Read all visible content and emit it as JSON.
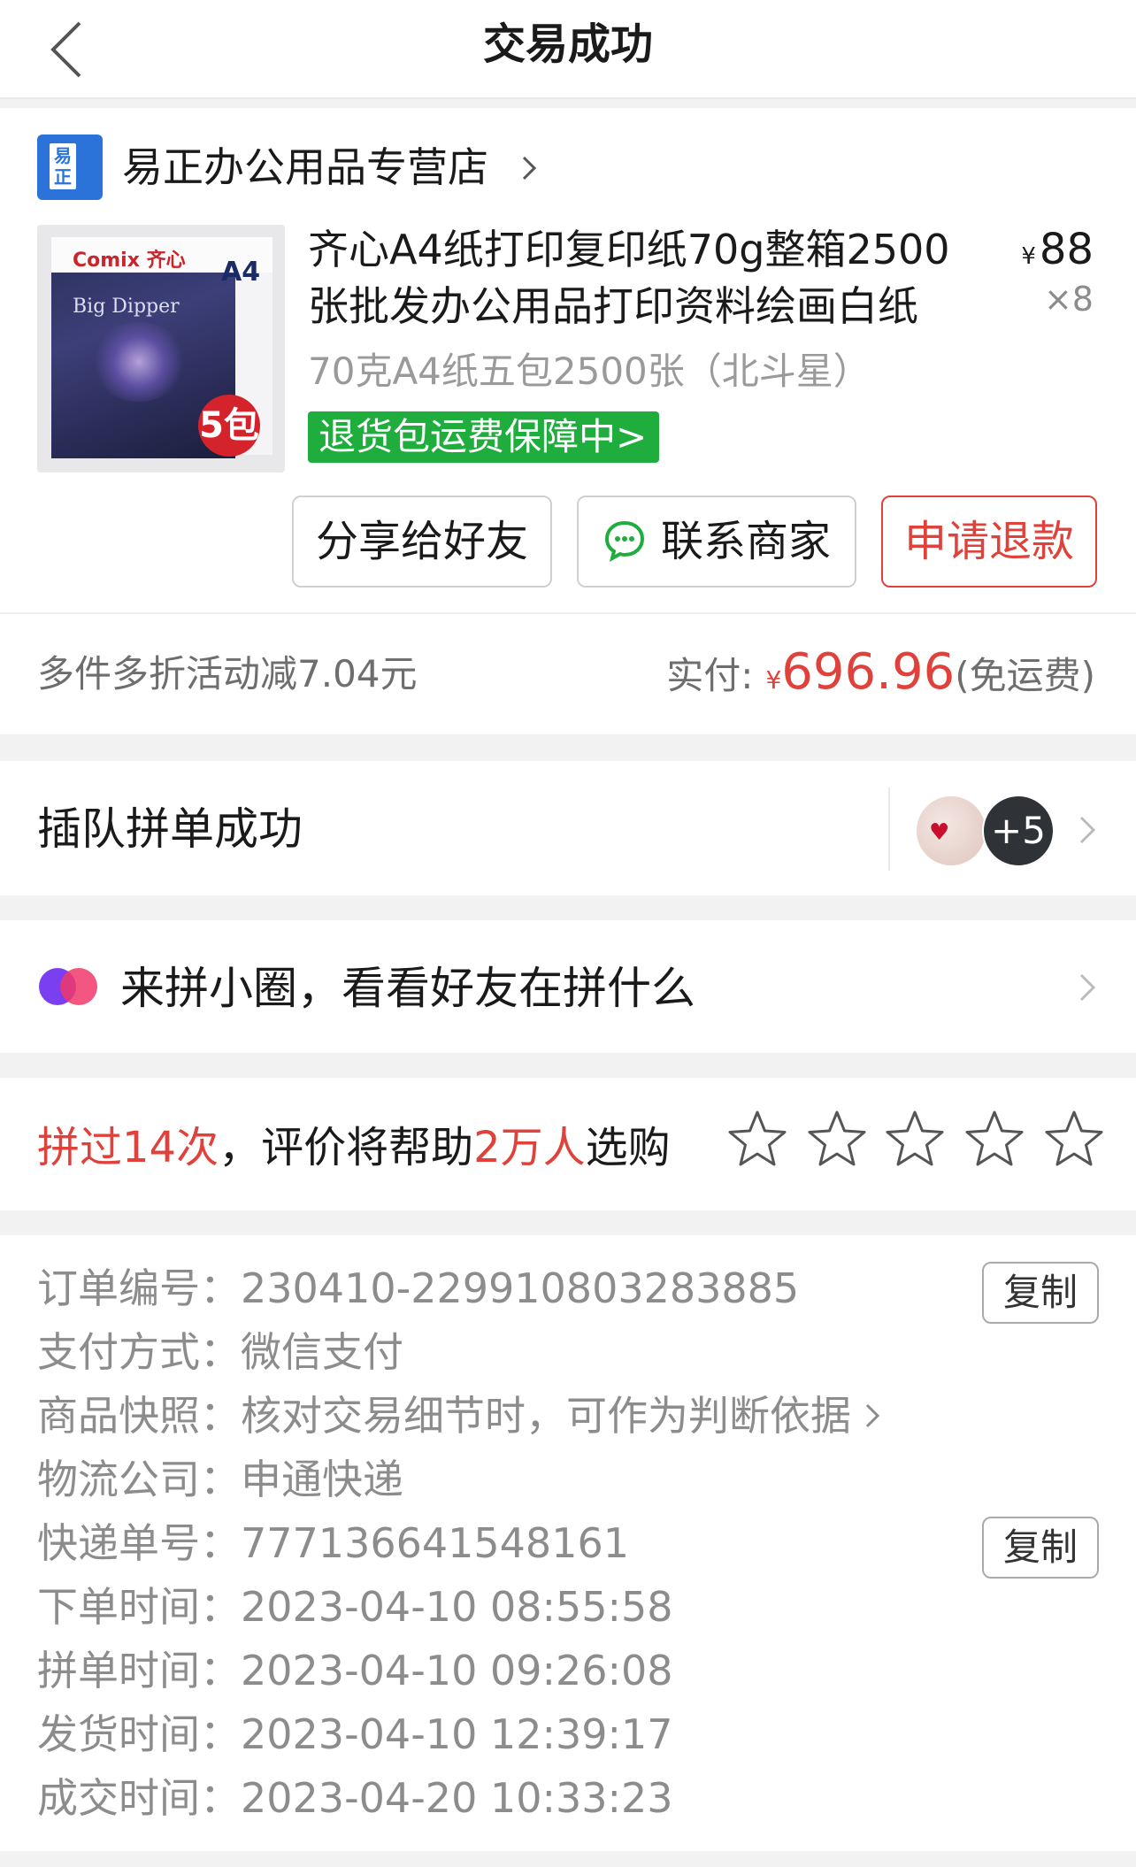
{
  "header": {
    "title": "交易成功"
  },
  "store": {
    "name": "易正办公用品专营店",
    "logo_text_1": "易",
    "logo_text_2": "正"
  },
  "product": {
    "image_brand": "Comix 齐心",
    "image_size": "A4",
    "image_series": "Big Dipper",
    "image_pack": "5包",
    "title": "齐心A4纸打印复印纸70g整箱2500张批发办公用品打印资料绘画白纸",
    "price_symbol": "¥",
    "price": "88",
    "quantity": "×8",
    "spec": "70克A4纸五包2500张（北斗星）",
    "insurance_badge": "退货包运费保障中>"
  },
  "actions": {
    "share_label": "分享给好友",
    "contact_label": "联系商家",
    "refund_label": "申请退款"
  },
  "summary": {
    "discount_text": "多件多折活动减7.04元",
    "paid_label": "实付:",
    "currency": "¥",
    "amount": "696.96",
    "shipping_note": "(免运费)"
  },
  "group": {
    "text": "插队拼单成功",
    "more_count": "+5"
  },
  "circle": {
    "text": "来拼小圈，看看好友在拼什么"
  },
  "rating": {
    "part1": "拼过14次",
    "part2": "，评价将帮助",
    "part3": "2万人",
    "part4": "选购",
    "stars_filled": 0,
    "stars_total": 5
  },
  "order_details": {
    "order_no_label": "订单编号：",
    "order_no": "230410-229910803283885",
    "payment_label": "支付方式：",
    "payment": "微信支付",
    "snapshot_label": "商品快照：",
    "snapshot": "核对交易细节时，可作为判断依据",
    "logistics_label": "物流公司：",
    "logistics": "申通快递",
    "tracking_label": "快递单号：",
    "tracking_no": "777136641548161",
    "order_time_label": "下单时间：",
    "order_time": "2023-04-10 08:55:58",
    "group_time_label": "拼单时间：",
    "group_time": "2023-04-10 09:26:08",
    "ship_time_label": "发货时间：",
    "ship_time": "2023-04-10 12:39:17",
    "deal_time_label": "成交时间：",
    "deal_time": "2023-04-20 10:33:23",
    "copy_label": "复制"
  },
  "colors": {
    "accent_red": "#e0413a",
    "badge_green": "#1fad3d",
    "store_blue": "#2b73d9",
    "muted_text": "#8c8c8c"
  }
}
